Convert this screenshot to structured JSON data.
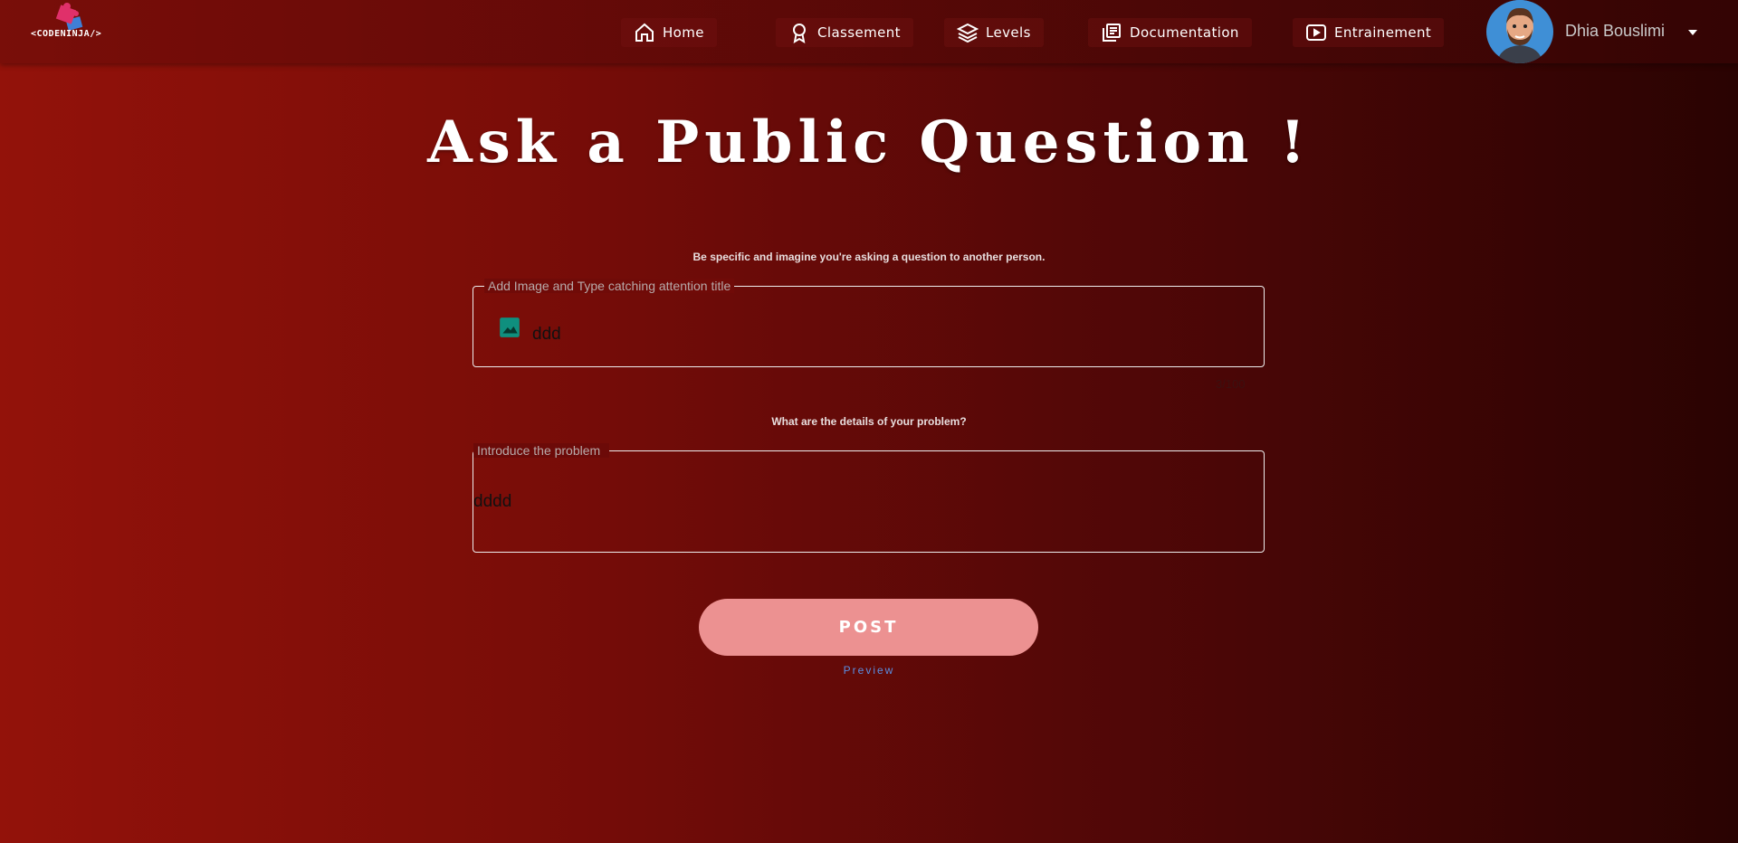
{
  "brand": {
    "logo_text": "<CODENINJA/>"
  },
  "nav": {
    "home": "Home",
    "classement": "Classement",
    "levels": "Levels",
    "documentation": "Documentation",
    "entrainement": "Entrainement"
  },
  "user": {
    "name": "Dhia Bouslimi"
  },
  "page": {
    "title": "Ask a Public Question !",
    "title_hint": "Be specific and imagine you're asking a question to another person.",
    "details_hint": "What are the details of your problem?"
  },
  "title_field": {
    "legend": "Add Image and Type catching attention title",
    "value": "ddd",
    "counter": "3/100"
  },
  "problem_field": {
    "legend": "Introduce the problem",
    "value": "dddd"
  },
  "actions": {
    "post": "POST",
    "preview": "Preview"
  },
  "colors": {
    "accent_button": "#ec9191",
    "preview_link": "#5a8fe3",
    "image_icon": "#0f8f7e",
    "avatar_bg": "#3f8fd6"
  }
}
